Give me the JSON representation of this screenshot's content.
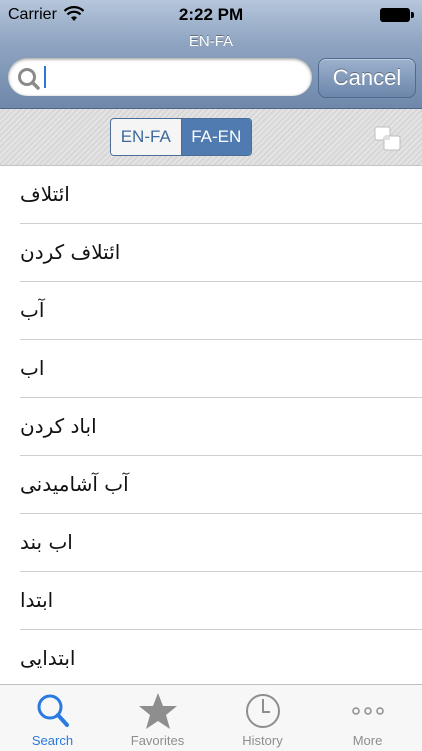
{
  "status_bar": {
    "carrier": "Carrier",
    "time": "2:22 PM"
  },
  "nav": {
    "title": "EN-FA"
  },
  "search": {
    "value": "",
    "placeholder": "",
    "cancel_label": "Cancel"
  },
  "segmented": {
    "options": [
      "EN-FA",
      "FA-EN"
    ],
    "selected": "FA-EN"
  },
  "words": [
    "ائتلاف",
    "ائتلاف کردن",
    "آب",
    "اب",
    "اباد کردن",
    "آب آشامیدنی",
    "اب بند",
    "ابتدا",
    "ابتدایی"
  ],
  "tabs": [
    {
      "label": "Search",
      "icon": "search-icon",
      "active": true
    },
    {
      "label": "Favorites",
      "icon": "star-icon",
      "active": false
    },
    {
      "label": "History",
      "icon": "clock-icon",
      "active": false
    },
    {
      "label": "More",
      "icon": "more-dots-icon",
      "active": false
    }
  ],
  "colors": {
    "accent": "#2a7ae2",
    "segment_selected": "#4f7bb1",
    "nav_bar": "#8ea4c1"
  }
}
